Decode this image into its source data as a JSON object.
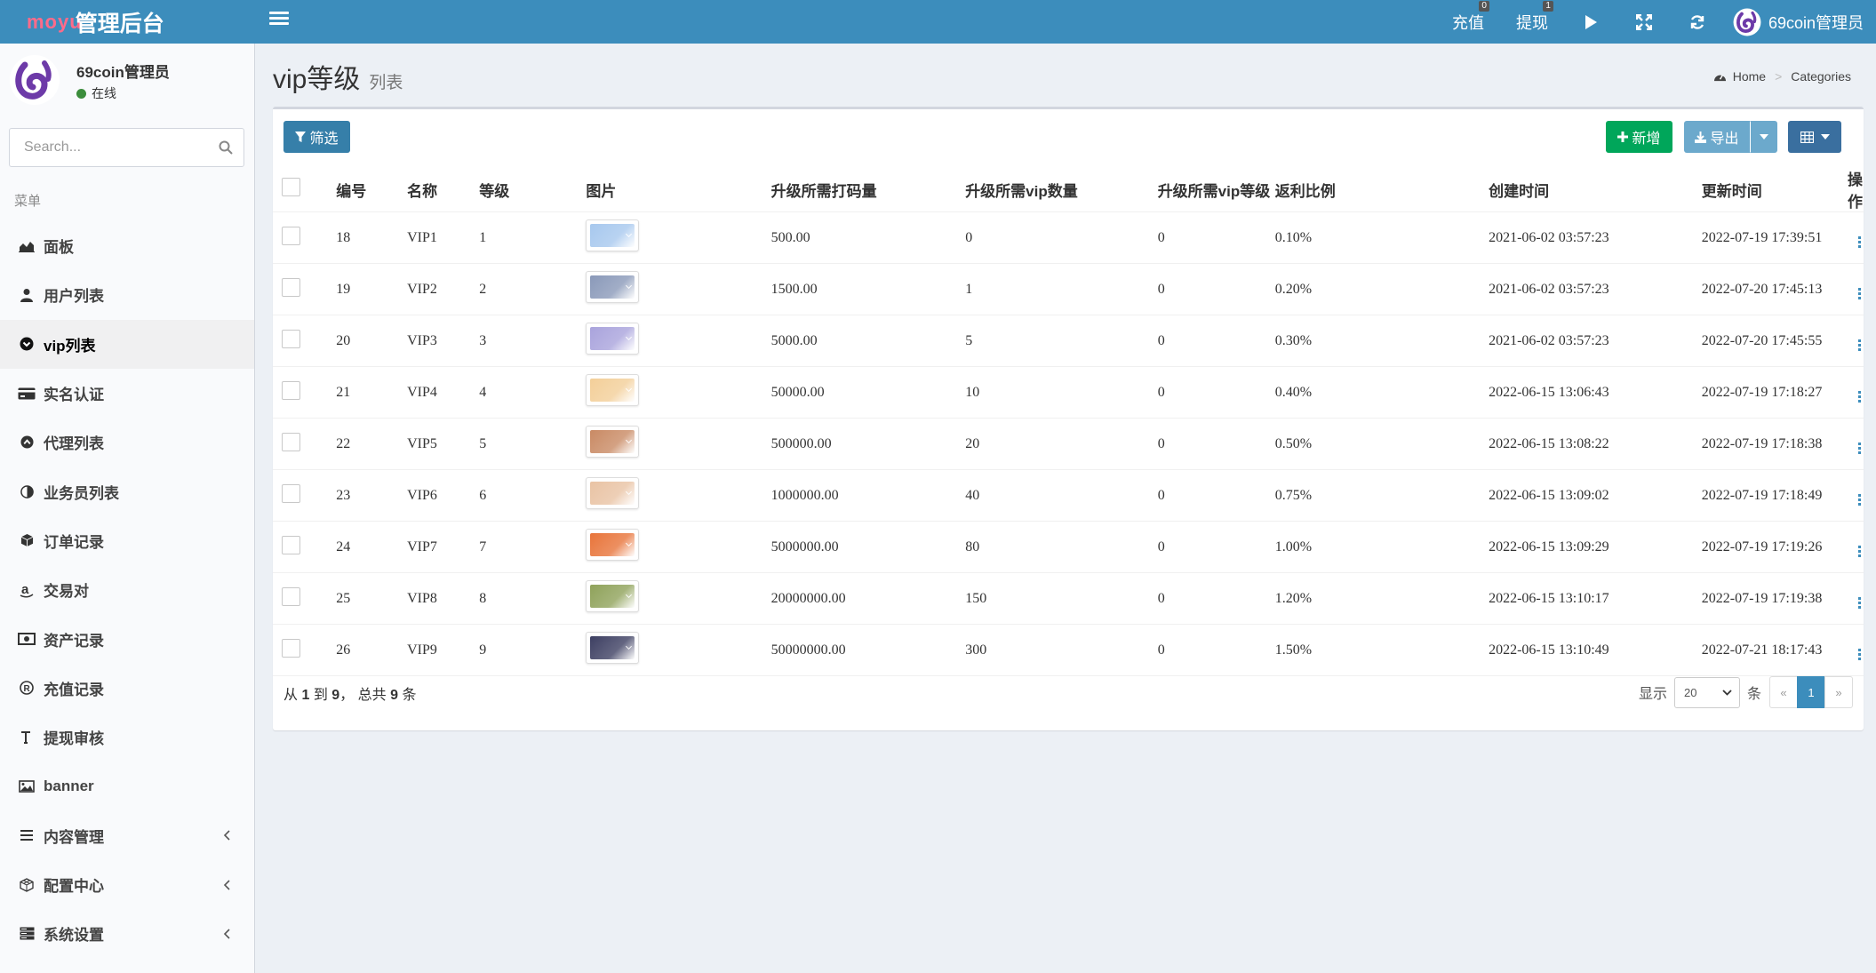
{
  "header": {
    "logo_mini": "moyu",
    "logo_full": "管理后台",
    "recharge_label": "充值",
    "recharge_badge": "0",
    "withdraw_label": "提现",
    "withdraw_badge": "1",
    "user_name": "69coin管理员"
  },
  "sidebar": {
    "user_name": "69coin管理员",
    "status": "在线",
    "search_placeholder": "Search...",
    "menu_header": "菜单",
    "items": [
      {
        "label": "面板",
        "icon": "area-chart-icon"
      },
      {
        "label": "用户列表",
        "icon": "user-icon"
      },
      {
        "label": "vip列表",
        "icon": "chevron-circle-icon"
      },
      {
        "label": "实名认证",
        "icon": "credit-card-icon"
      },
      {
        "label": "代理列表",
        "icon": "arrow-circle-icon"
      },
      {
        "label": "业务员列表",
        "icon": "adjust-icon"
      },
      {
        "label": "订单记录",
        "icon": "cube-icon"
      },
      {
        "label": "交易对",
        "icon": "amazon-icon"
      },
      {
        "label": "资产记录",
        "icon": "money-icon"
      },
      {
        "label": "充值记录",
        "icon": "registered-icon"
      },
      {
        "label": "提现审核",
        "icon": "text-height-icon"
      },
      {
        "label": "banner",
        "icon": "image-icon"
      },
      {
        "label": "内容管理",
        "icon": "list-icon"
      },
      {
        "label": "配置中心",
        "icon": "cubes-icon"
      },
      {
        "label": "系统设置",
        "icon": "server-icon"
      }
    ]
  },
  "page": {
    "title": "vip等级",
    "subtitle": "列表",
    "breadcrumb_home": "Home",
    "breadcrumb_current": "Categories"
  },
  "toolbar": {
    "filter_label": "筛选",
    "add_label": "新增",
    "export_label": "导出"
  },
  "table": {
    "headers": [
      "编号",
      "名称",
      "等级",
      "图片",
      "升级所需打码量",
      "升级所需vip数量",
      "升级所需vip等级",
      "返利比例",
      "创建时间",
      "更新时间",
      "操作"
    ],
    "rows": [
      {
        "id": "18",
        "name": "VIP1",
        "level": "1",
        "color": "#a7c8ee",
        "bet": "500.00",
        "vip_count": "0",
        "vip_level": "0",
        "rebate": "0.10%",
        "created": "2021-06-02 03:57:23",
        "updated": "2022-07-19 17:39:51"
      },
      {
        "id": "19",
        "name": "VIP2",
        "level": "2",
        "color": "#8a99b9",
        "bet": "1500.00",
        "vip_count": "1",
        "vip_level": "0",
        "rebate": "0.20%",
        "created": "2021-06-02 03:57:23",
        "updated": "2022-07-20 17:45:13"
      },
      {
        "id": "20",
        "name": "VIP3",
        "level": "3",
        "color": "#a9a3dc",
        "bet": "5000.00",
        "vip_count": "5",
        "vip_level": "0",
        "rebate": "0.30%",
        "created": "2021-06-02 03:57:23",
        "updated": "2022-07-20 17:45:55"
      },
      {
        "id": "21",
        "name": "VIP4",
        "level": "4",
        "color": "#f3cf99",
        "bet": "50000.00",
        "vip_count": "10",
        "vip_level": "0",
        "rebate": "0.40%",
        "created": "2022-06-15 13:06:43",
        "updated": "2022-07-19 17:18:27"
      },
      {
        "id": "22",
        "name": "VIP5",
        "level": "5",
        "color": "#c98a64",
        "bet": "500000.00",
        "vip_count": "20",
        "vip_level": "0",
        "rebate": "0.50%",
        "created": "2022-06-15 13:08:22",
        "updated": "2022-07-19 17:18:38"
      },
      {
        "id": "23",
        "name": "VIP6",
        "level": "6",
        "color": "#e9c3a4",
        "bet": "1000000.00",
        "vip_count": "40",
        "vip_level": "0",
        "rebate": "0.75%",
        "created": "2022-06-15 13:09:02",
        "updated": "2022-07-19 17:18:49"
      },
      {
        "id": "24",
        "name": "VIP7",
        "level": "7",
        "color": "#e8743a",
        "bet": "5000000.00",
        "vip_count": "80",
        "vip_level": "0",
        "rebate": "1.00%",
        "created": "2022-06-15 13:09:29",
        "updated": "2022-07-19 17:19:26"
      },
      {
        "id": "25",
        "name": "VIP8",
        "level": "8",
        "color": "#8fa25a",
        "bet": "20000000.00",
        "vip_count": "150",
        "vip_level": "0",
        "rebate": "1.20%",
        "created": "2022-06-15 13:10:17",
        "updated": "2022-07-19 17:19:38"
      },
      {
        "id": "26",
        "name": "VIP9",
        "level": "9",
        "color": "#3d3f62",
        "bet": "50000000.00",
        "vip_count": "300",
        "vip_level": "0",
        "rebate": "1.50%",
        "created": "2022-06-15 13:10:49",
        "updated": "2022-07-21 18:17:43"
      }
    ]
  },
  "footer": {
    "prefix": "从",
    "from": "1",
    "to_word": "到",
    "to": "9",
    "total_word": "， 总共",
    "total": "9",
    "unit": "条",
    "show_label": "显示",
    "page_size": "20",
    "per_unit": "条",
    "prev": "«",
    "current_page": "1",
    "next": "»"
  }
}
